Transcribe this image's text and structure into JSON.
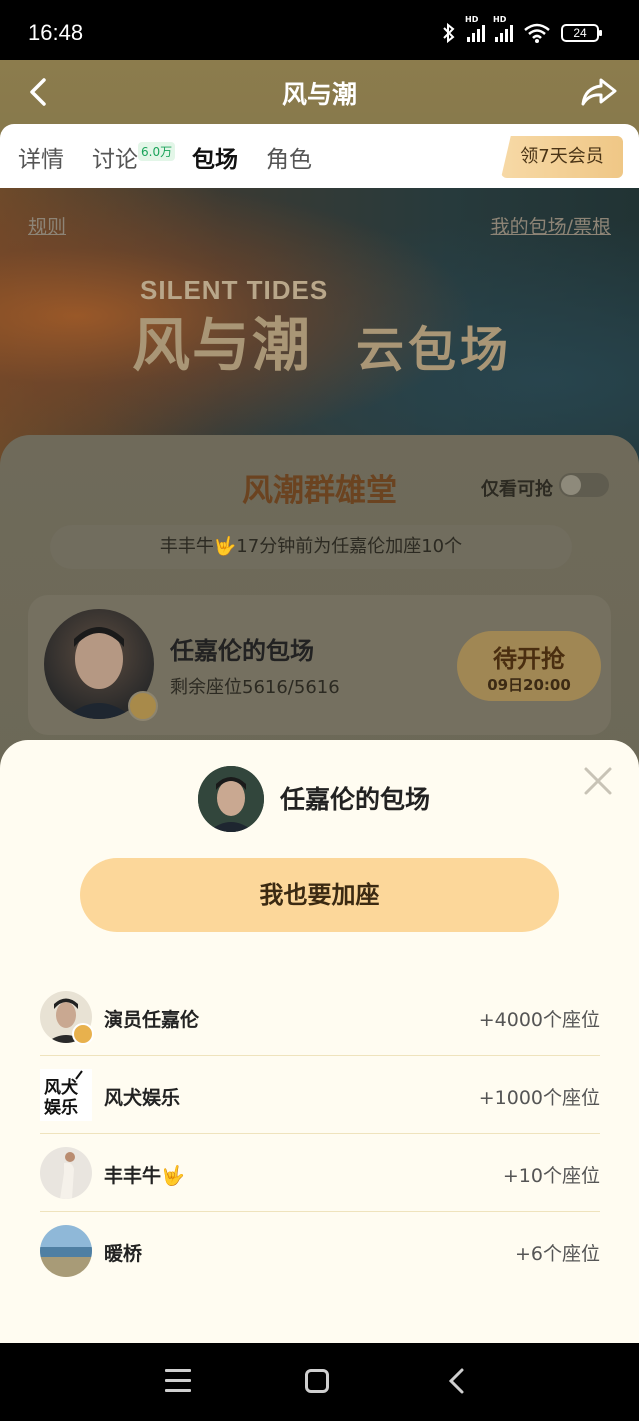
{
  "status_bar": {
    "time": "16:48",
    "battery": "24",
    "network_badge": "HD"
  },
  "nav": {
    "title": "风与潮",
    "back_icon": "back-arrow-icon",
    "share_icon": "share-icon"
  },
  "tabs": {
    "items": [
      {
        "label": "详情",
        "active": false
      },
      {
        "label": "讨论",
        "active": false,
        "badge": "6.0万"
      },
      {
        "label": "包场",
        "active": true
      },
      {
        "label": "角色",
        "active": false
      }
    ],
    "vip_button": "领7天会员"
  },
  "poster": {
    "rules_link": "规则",
    "my_link": "我的包场/票根",
    "title_en": "SILENT TIDES",
    "title_cn": "风与潮",
    "subtitle_cn": "云包场"
  },
  "hall": {
    "title": "风潮群雄堂",
    "filter_label": "仅看可抢",
    "ticker": "丰丰牛🤟17分钟前为任嘉伦加座10个",
    "box": {
      "name": "任嘉伦的包场",
      "seats": "剩余座位5616/5616",
      "status_label": "待开抢",
      "status_time": "09日20:00"
    }
  },
  "sheet": {
    "title": "任嘉伦的包场",
    "join_button": "我也要加座",
    "close_icon": "close-icon",
    "contributors": [
      {
        "name": "演员任嘉伦",
        "seats": "+4000个座位"
      },
      {
        "name": "风犬娱乐",
        "seats": "+1000个座位"
      },
      {
        "name": "丰丰牛🤟",
        "seats": "+10个座位"
      },
      {
        "name": "暖桥",
        "seats": "+6个座位"
      }
    ],
    "logo_text": "风犬娱乐"
  },
  "colors": {
    "accent": "#fcd79a",
    "sheet_bg": "#fffcf1",
    "vip": "#efc786",
    "badge_green": "#1aa35a"
  }
}
